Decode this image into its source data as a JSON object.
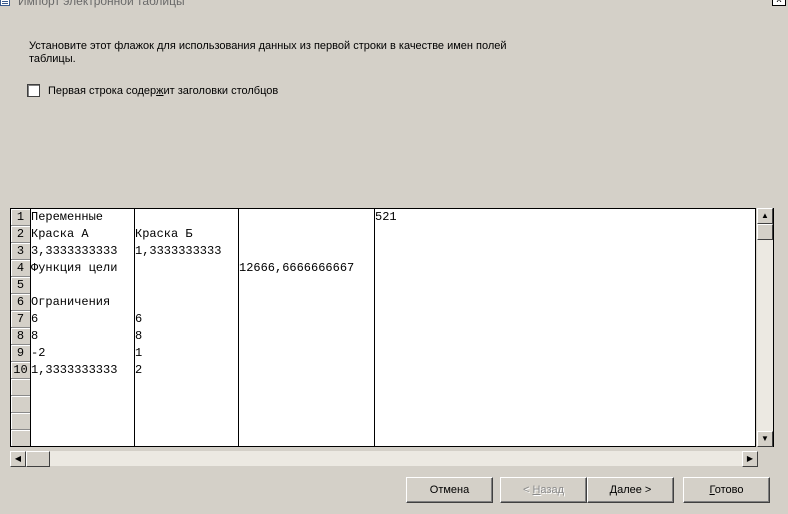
{
  "window": {
    "title": "Импорт электронной таблицы",
    "close_label": "x"
  },
  "instruction": "Установите этот флажок для использования данных из первой строки в качестве имен полей таблицы.",
  "checkbox": {
    "label_before": "Первая строка содер",
    "label_accel": "ж",
    "label_after": "ит заголовки столбцов",
    "checked": false
  },
  "preview": {
    "row_numbers": [
      "1",
      "2",
      "3",
      "4",
      "5",
      "6",
      "7",
      "8",
      "9",
      "10",
      "",
      "",
      "",
      ""
    ],
    "rows": [
      [
        "Переменные",
        "",
        "",
        "521"
      ],
      [
        "Краска А",
        "Краска Б",
        "",
        ""
      ],
      [
        "3,3333333333",
        "1,3333333333",
        "",
        ""
      ],
      [
        "Функция цели",
        "",
        "12666,6666666667",
        ""
      ],
      [
        "",
        "",
        "",
        ""
      ],
      [
        "Ограничения",
        "",
        "",
        ""
      ],
      [
        "6",
        "6",
        "",
        ""
      ],
      [
        "8",
        "8",
        "",
        ""
      ],
      [
        "-2",
        "1",
        "",
        ""
      ],
      [
        "1,3333333333",
        "2",
        "",
        ""
      ]
    ]
  },
  "buttons": {
    "cancel": "Отмена",
    "back_arrow": "< ",
    "back_accel": "Н",
    "back_rest": "азад",
    "next_accel": "Д",
    "next_rest": "алее >",
    "finish_accel": "Г",
    "finish_rest": "отово"
  },
  "icons": {
    "scroll_up": "up-arrow-icon",
    "scroll_down": "down-arrow-icon",
    "scroll_left": "left-arrow-icon",
    "scroll_right": "right-arrow-icon"
  }
}
